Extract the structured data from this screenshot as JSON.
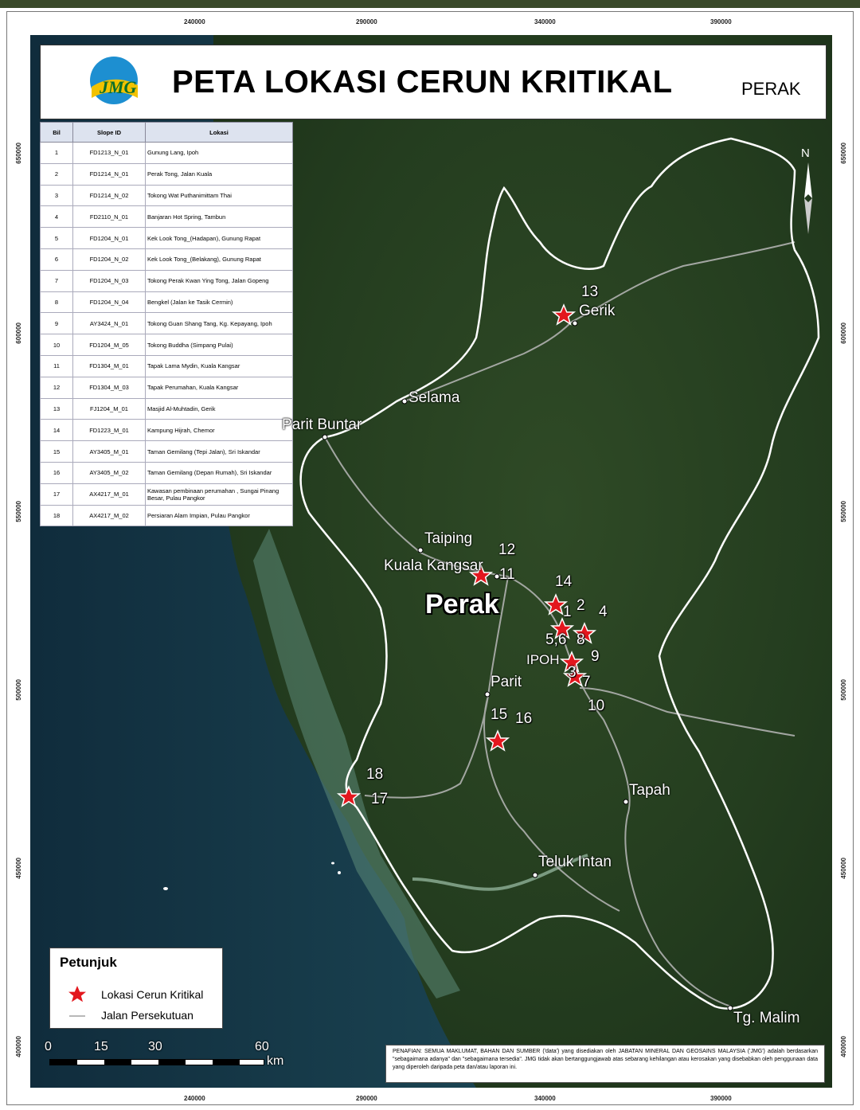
{
  "title": "PETA LOKASI CERUN KRITIKAL",
  "state_label": "PERAK",
  "logo_text": "JMG",
  "region_label": "Perak",
  "north_label": "N",
  "grid_ticks": {
    "top": [
      "240000",
      "290000",
      "340000",
      "390000"
    ],
    "bottom": [
      "240000",
      "290000",
      "340000",
      "390000"
    ],
    "left": [
      "650000",
      "600000",
      "550000",
      "500000",
      "450000",
      "400000"
    ],
    "right": [
      "650000",
      "600000",
      "550000",
      "500000",
      "450000",
      "400000"
    ]
  },
  "table": {
    "headers": [
      "Bil",
      "Slope ID",
      "Lokasi"
    ],
    "rows": [
      [
        "1",
        "FD1213_N_01",
        "Gunung Lang, Ipoh"
      ],
      [
        "2",
        "FD1214_N_01",
        "Perak Tong, Jalan Kuala"
      ],
      [
        "3",
        "FD1214_N_02",
        "Tokong Wat Puthanimittam Thai"
      ],
      [
        "4",
        "FD2110_N_01",
        "Banjaran Hot Spring, Tambun"
      ],
      [
        "5",
        "FD1204_N_01",
        "Kek Look Tong_(Hadapan), Gunung Rapat"
      ],
      [
        "6",
        "FD1204_N_02",
        "Kek Look Tong_(Belakang), Gunung Rapat"
      ],
      [
        "7",
        "FD1204_N_03",
        "Tokong Perak Kwan Ying Tong, Jalan Gopeng"
      ],
      [
        "8",
        "FD1204_N_04",
        "Bengkel (Jalan ke Tasik Cermin)"
      ],
      [
        "9",
        "AY3424_N_01",
        "Tokong Guan Shang Tang, Kg. Kepayang, Ipoh"
      ],
      [
        "10",
        "FD1204_M_05",
        "Tokong Buddha (Simpang Pulai)"
      ],
      [
        "11",
        "FD1304_M_01",
        "Tapak Lama Mydin, Kuala Kangsar"
      ],
      [
        "12",
        "FD1304_M_03",
        "Tapak Perumahan, Kuala Kangsar"
      ],
      [
        "13",
        "FJ1204_M_01",
        "Masjid Al-Muhtadin, Gerik"
      ],
      [
        "14",
        "FD1223_M_01",
        "Kampung Hijrah, Chemor"
      ],
      [
        "15",
        "AY3405_M_01",
        "Taman Gemilang (Tepi Jalan), Sri Iskandar"
      ],
      [
        "16",
        "AY3405_M_02",
        "Taman Gemilang (Depan Rumah), Sri Iskandar"
      ],
      [
        "17",
        "AX4217_M_01",
        "Kawasan pembinaan perumahan , Sungai Pinang Besar, Pulau Pangkor"
      ],
      [
        "18",
        "AX4217_M_02",
        "Persiaran Alam Impian, Pulau Pangkor"
      ]
    ]
  },
  "towns": {
    "gerik": "Gerik",
    "selama": "Selama",
    "parit_buntar": "Parit Buntar",
    "taiping": "Taiping",
    "kuala_kangsar": "Kuala Kangsar",
    "ipoh": "IPOH",
    "parit": "Parit",
    "tapah": "Tapah",
    "teluk_intan": "Teluk Intan",
    "tg_malim": "Tg. Malim"
  },
  "site_labels": {
    "n13": "13",
    "n12": "12",
    "n11": "11",
    "n14": "14",
    "n1": "1",
    "n2": "2",
    "n4": "4",
    "n568": "5,6",
    "n8": "8",
    "n9": "9",
    "n3": "3",
    "n7": "7",
    "n10": "10",
    "n15": "15",
    "n16": "16",
    "n18": "18",
    "n17": "17"
  },
  "legend": {
    "title": "Petunjuk",
    "items": [
      "Lokasi Cerun Kritikal",
      "Jalan Persekutuan"
    ]
  },
  "scale": {
    "ticks": [
      "0",
      "15",
      "30",
      "60"
    ],
    "unit": "km"
  },
  "disclaimer": "PENAFIAN: SEMUA MAKLUMAT, BAHAN DAN SUMBER ('data') yang disediakan oleh JABATAN MINERAL DAN GEOSAINS MALAYSIA ('JMG') adalah berdasarkan \"sebagaimana adanya\" dan \"sebagaimana tersedia\". JMG tidak akan bertanggungjawab atas sebarang kehilangan atau kerosakan yang disebabkan oleh penggunaan data yang diperoleh daripada peta dan/atau laporan ini.",
  "colors": {
    "marker": "#e3171e",
    "road": "#b8b8b8",
    "boundary": "#ffffff",
    "sea": "#1d3f4c"
  }
}
